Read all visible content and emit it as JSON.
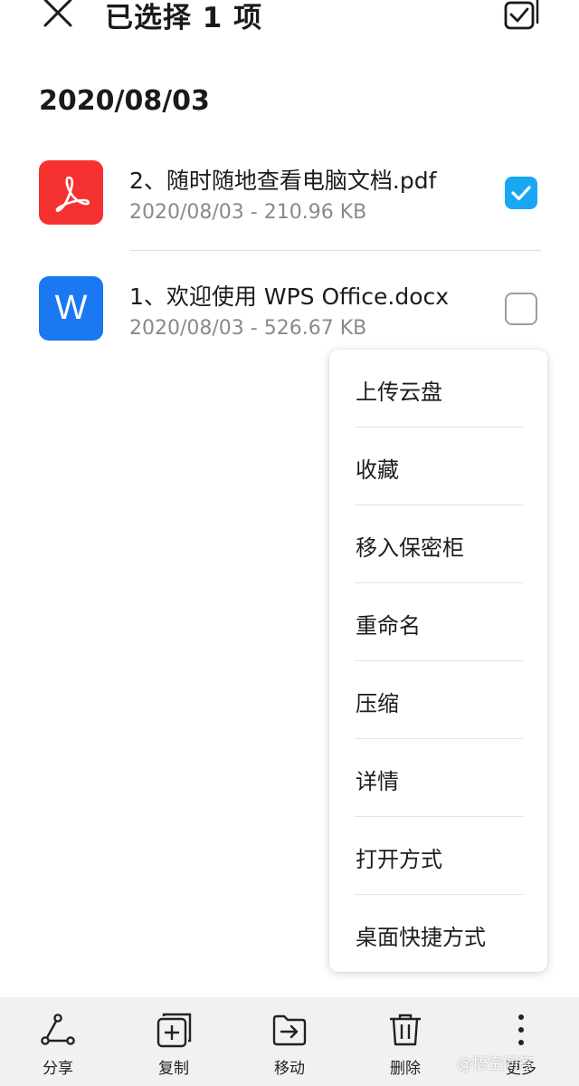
{
  "header": {
    "title": "已选择 1 项"
  },
  "date_header": "2020/08/03",
  "files": [
    {
      "name": "2、随时随地查看电脑文档.pdf",
      "meta": "2020/08/03 - 210.96 KB",
      "type": "pdf",
      "checked": true,
      "color": "#f5322f"
    },
    {
      "name": "1、欢迎使用 WPS Office.docx",
      "meta": "2020/08/03 - 526.67 KB",
      "type": "docx",
      "checked": false,
      "color": "#1a78f2",
      "icon_letter": "W"
    }
  ],
  "menu": {
    "items": [
      {
        "label": "上传云盘"
      },
      {
        "label": "收藏"
      },
      {
        "label": "移入保密柜"
      },
      {
        "label": "重命名"
      },
      {
        "label": "压缩"
      },
      {
        "label": "详情"
      },
      {
        "label": "打开方式"
      },
      {
        "label": "桌面快捷方式"
      }
    ]
  },
  "toolbar": {
    "share_label": "分享",
    "copy_label": "复制",
    "move_label": "移动",
    "delete_label": "删除",
    "more_label": "更多"
  },
  "watermark": "@悟空问答",
  "colors": {
    "accent": "#1aa7f2",
    "pdf": "#f5322f",
    "word": "#1a78f2"
  }
}
